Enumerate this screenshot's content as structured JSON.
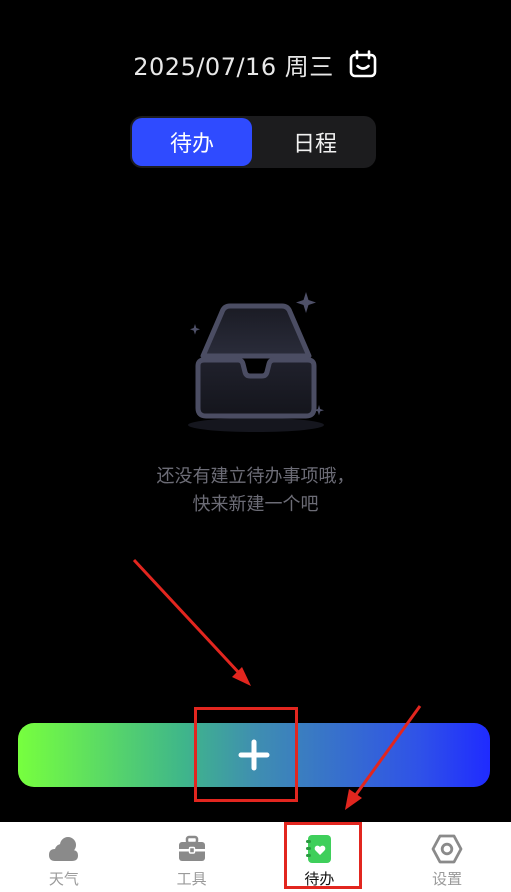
{
  "header": {
    "date": "2025/07/16 周三",
    "calendar_icon": "calendar-icon"
  },
  "segment": {
    "tabs": [
      {
        "label": "待办",
        "active": true
      },
      {
        "label": "日程",
        "active": false
      }
    ]
  },
  "empty_state": {
    "line1": "还没有建立待办事项哦，",
    "line2": "快来新建一个吧",
    "icon": "empty-inbox-icon"
  },
  "add_button": {
    "icon": "plus-icon"
  },
  "tabbar": {
    "items": [
      {
        "label": "天气",
        "icon": "weather-cloud-icon",
        "active": false
      },
      {
        "label": "工具",
        "icon": "toolbox-icon",
        "active": false
      },
      {
        "label": "待办",
        "icon": "todo-note-icon",
        "active": true
      },
      {
        "label": "设置",
        "icon": "settings-hexagon-icon",
        "active": false
      }
    ]
  },
  "colors": {
    "accent": "#2f4bff",
    "annotation": "#e2261f",
    "todo_green": "#3fcf5b"
  }
}
